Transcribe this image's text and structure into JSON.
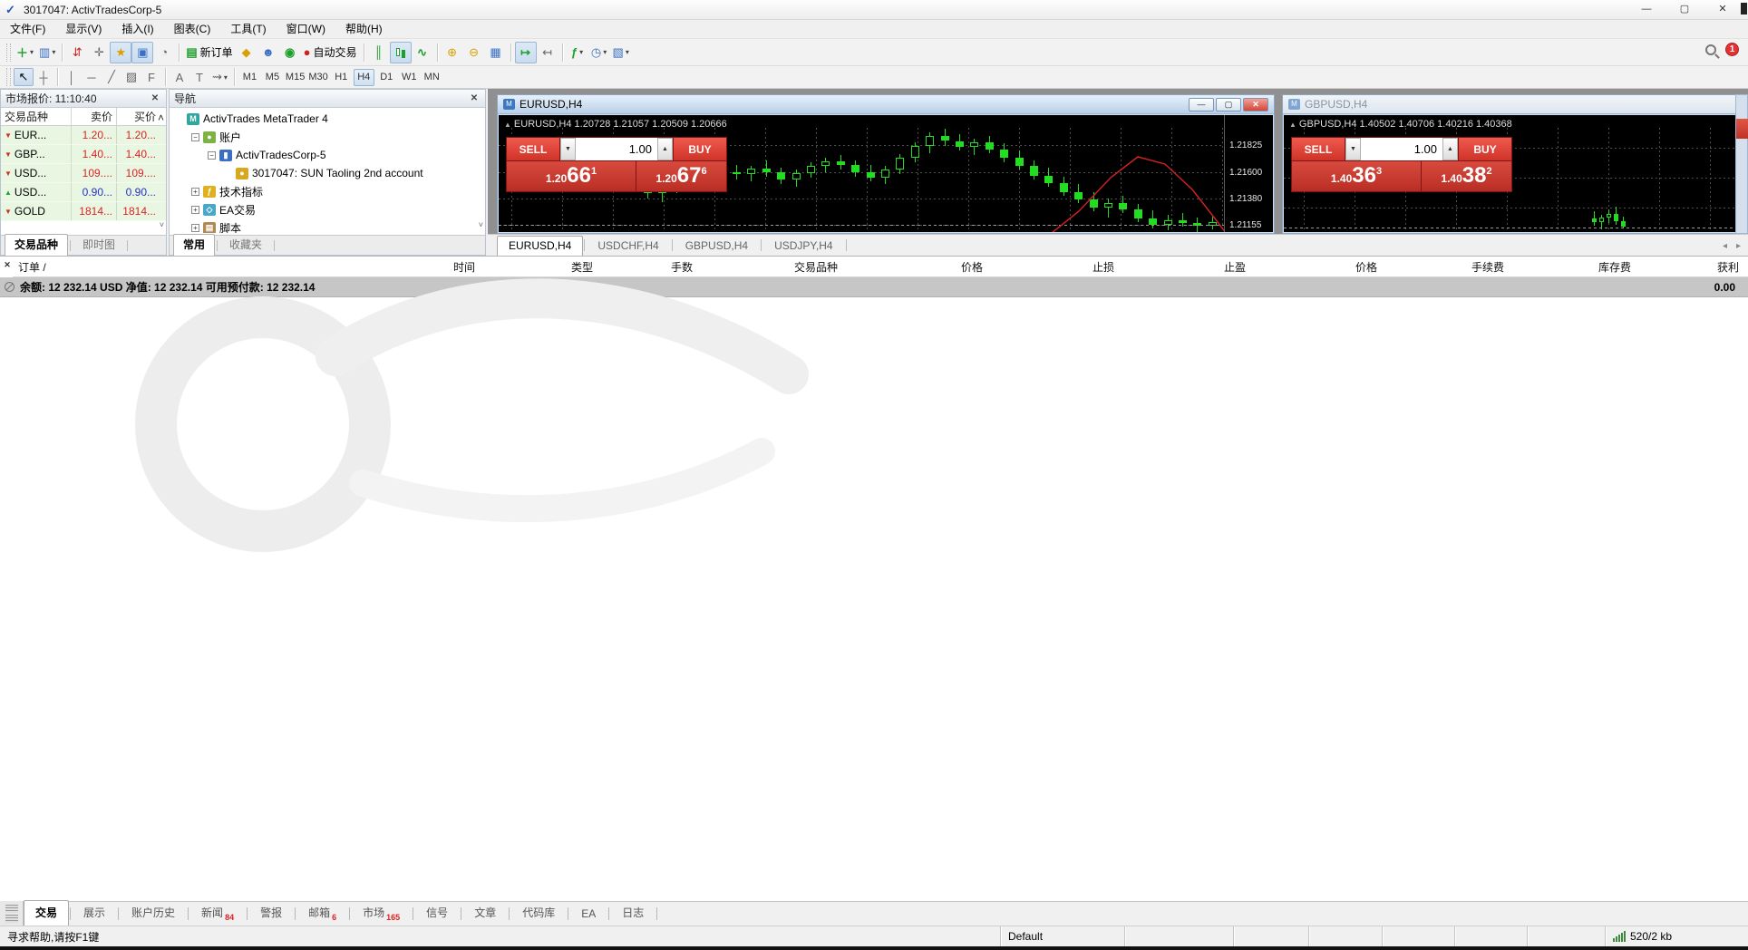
{
  "window": {
    "title": "3017047: ActivTradesCorp-5"
  },
  "icons": {
    "app_logo": "✓",
    "minimize": "—",
    "maximize": "▢",
    "close": "✕",
    "dropdown": "▾",
    "collapse_tri": "▲",
    "new_chart": "＋",
    "profiles": "▥",
    "market_watch": "⇵",
    "data_window": "✛",
    "navigator": "★",
    "terminal_panel": "▣",
    "strategy_tester": "◔",
    "new_order": "▤",
    "metaeditor": "◆",
    "mql_editor": "☻",
    "signals": "◉",
    "autotrading_stop": "●",
    "bar_chart": "║",
    "line_chart": "∿",
    "zoom_in": "⊕",
    "zoom_out": "⊖",
    "tile_windows": "▦",
    "auto_scroll": "↦",
    "chart_shift": "↤",
    "indicators": "ƒ",
    "periods": "◷",
    "templates": "▧",
    "cursor": "↖",
    "crosshair": "┼",
    "vline": "│",
    "hline": "─",
    "trendline": "╱",
    "channel": "▨",
    "fibonacci": "F",
    "text": "A",
    "text_label": "T",
    "arrows_tool": "⇝",
    "scroll_up": "˄",
    "scroll_down": "˅",
    "tab_left": "◂",
    "tab_right": "▸",
    "up_arrow": "▲",
    "down_arrow": "▼",
    "tree_minus": "−",
    "tree_plus": "+",
    "spin_up": "▲",
    "spin_down": "▼",
    "chart_doc": "▤"
  },
  "menu": {
    "items": [
      "文件(F)",
      "显示(V)",
      "插入(I)",
      "图表(C)",
      "工具(T)",
      "窗口(W)",
      "帮助(H)"
    ]
  },
  "toolbar": {
    "new_order_label": "新订单",
    "autotrading_label": "自动交易",
    "notification_count": "1",
    "timeframes": [
      "M1",
      "M5",
      "M15",
      "M30",
      "H1",
      "H4",
      "D1",
      "W1",
      "MN"
    ],
    "active_timeframe": "H4"
  },
  "market_watch": {
    "title": "市场报价: 11:10:40",
    "columns": [
      "交易品种",
      "卖价",
      "买价"
    ],
    "rows": [
      {
        "symbol": "EUR...",
        "bid": "1.20...",
        "ask": "1.20...",
        "dir": "down",
        "trend": "red"
      },
      {
        "symbol": "GBP...",
        "bid": "1.40...",
        "ask": "1.40...",
        "dir": "down",
        "trend": "red"
      },
      {
        "symbol": "USD...",
        "bid": "109....",
        "ask": "109....",
        "dir": "down",
        "trend": "red"
      },
      {
        "symbol": "USD...",
        "bid": "0.90...",
        "ask": "0.90...",
        "dir": "up",
        "trend": "blue"
      },
      {
        "symbol": "GOLD",
        "bid": "1814...",
        "ask": "1814...",
        "dir": "down",
        "trend": "red"
      }
    ],
    "tabs": [
      {
        "label": "交易品种",
        "active": true
      },
      {
        "label": "即时图",
        "active": false
      }
    ]
  },
  "navigator": {
    "title": "导航",
    "tree": [
      {
        "label": "ActivTrades MetaTrader 4",
        "level": 0,
        "icon": "app",
        "toggle": ""
      },
      {
        "label": "账户",
        "level": 1,
        "icon": "accounts",
        "toggle": "minus"
      },
      {
        "label": "ActivTradesCorp-5",
        "level": 2,
        "icon": "server",
        "toggle": "minus"
      },
      {
        "label": "3017047: SUN Taoling 2nd account",
        "level": 3,
        "icon": "account",
        "toggle": ""
      },
      {
        "label": "技术指标",
        "level": 1,
        "icon": "indicator",
        "toggle": "plus"
      },
      {
        "label": "EA交易",
        "level": 1,
        "icon": "ea",
        "toggle": "plus"
      },
      {
        "label": "脚本",
        "level": 1,
        "icon": "script",
        "toggle": "plus"
      }
    ],
    "tabs": [
      {
        "label": "常用",
        "active": true
      },
      {
        "label": "收藏夹",
        "active": false
      }
    ]
  },
  "charts": {
    "eurusd": {
      "title": "EURUSD,H4",
      "ohlc": "EURUSD,H4  1.20728 1.21057 1.20509 1.20666",
      "sell_label": "SELL",
      "buy_label": "BUY",
      "volume": "1.00",
      "bid": {
        "prefix": "1.20",
        "big": "66",
        "sup": "1"
      },
      "ask": {
        "prefix": "1.20",
        "big": "67",
        "sup": "6"
      }
    },
    "gbpusd": {
      "title": "GBPUSD,H4",
      "ohlc": "GBPUSD,H4  1.40502 1.40706 1.40216 1.40368",
      "sell_label": "SELL",
      "buy_label": "BUY",
      "volume": "1.00",
      "bid": {
        "prefix": "1.40",
        "big": "36",
        "sup": "3"
      },
      "ask": {
        "prefix": "1.40",
        "big": "38",
        "sup": "2"
      }
    },
    "tabs": [
      {
        "label": "EURUSD,H4",
        "active": true
      },
      {
        "label": "USDCHF,H4",
        "active": false
      },
      {
        "label": "GBPUSD,H4",
        "active": false
      },
      {
        "label": "USDJPY,H4",
        "active": false
      }
    ]
  },
  "chart_data": [
    {
      "type": "candlestick",
      "symbol": "EURUSD",
      "timeframe": "H4",
      "ohlc_display": [
        1.20728,
        1.21057,
        1.20509,
        1.20666
      ],
      "y_axis": {
        "min": 1.2109,
        "max": 1.2197,
        "ticks": [
          "1.21825",
          "1.21600",
          "1.21380",
          "1.21155"
        ]
      },
      "current_price_line": 1.21155,
      "grid": true,
      "candles": [
        [
          1.2165,
          1.2176,
          1.2158,
          1.217
        ],
        [
          1.217,
          1.2178,
          1.2164,
          1.2166
        ],
        [
          1.2166,
          1.2172,
          1.2156,
          1.216
        ],
        [
          1.216,
          1.2168,
          1.2154,
          1.2165
        ],
        [
          1.2165,
          1.217,
          1.2157,
          1.2161
        ],
        [
          1.2161,
          1.2166,
          1.215,
          1.2153
        ],
        [
          1.2153,
          1.2162,
          1.2147,
          1.2158
        ],
        [
          1.2158,
          1.2164,
          1.2152,
          1.2155
        ],
        [
          1.2155,
          1.216,
          1.2144,
          1.2147
        ],
        [
          1.2147,
          1.2154,
          1.2138,
          1.2142
        ],
        [
          1.2142,
          1.215,
          1.2135,
          1.2146
        ],
        [
          1.2146,
          1.2156,
          1.2142,
          1.2154
        ],
        [
          1.2154,
          1.216,
          1.2148,
          1.2152
        ],
        [
          1.2152,
          1.2158,
          1.2144,
          1.2156
        ],
        [
          1.2156,
          1.2164,
          1.215,
          1.216
        ],
        [
          1.216,
          1.2166,
          1.2154,
          1.2158
        ],
        [
          1.2158,
          1.2165,
          1.2152,
          1.2163
        ],
        [
          1.2163,
          1.217,
          1.2156,
          1.216
        ],
        [
          1.216,
          1.2164,
          1.215,
          1.2154
        ],
        [
          1.2154,
          1.2162,
          1.2148,
          1.2159
        ],
        [
          1.2159,
          1.2168,
          1.2155,
          1.2165
        ],
        [
          1.2165,
          1.2172,
          1.216,
          1.2169
        ],
        [
          1.2169,
          1.2174,
          1.2162,
          1.2166
        ],
        [
          1.2166,
          1.217,
          1.2156,
          1.216
        ],
        [
          1.216,
          1.2166,
          1.2152,
          1.2155
        ],
        [
          1.2155,
          1.2165,
          1.215,
          1.2162
        ],
        [
          1.2162,
          1.2175,
          1.2158,
          1.2172
        ],
        [
          1.2172,
          1.2185,
          1.2168,
          1.2182
        ],
        [
          1.2182,
          1.2193,
          1.2176,
          1.219
        ],
        [
          1.219,
          1.2196,
          1.2182,
          1.2186
        ],
        [
          1.2186,
          1.2192,
          1.2178,
          1.2181
        ],
        [
          1.2181,
          1.2188,
          1.2174,
          1.2185
        ],
        [
          1.2185,
          1.219,
          1.2176,
          1.2179
        ],
        [
          1.2179,
          1.2184,
          1.2168,
          1.2172
        ],
        [
          1.2172,
          1.2178,
          1.2162,
          1.2165
        ],
        [
          1.2165,
          1.217,
          1.2154,
          1.2157
        ],
        [
          1.2157,
          1.2164,
          1.2148,
          1.2151
        ],
        [
          1.2151,
          1.2156,
          1.214,
          1.2143
        ],
        [
          1.2143,
          1.215,
          1.2134,
          1.2137
        ],
        [
          1.2137,
          1.2143,
          1.2127,
          1.213
        ],
        [
          1.213,
          1.2138,
          1.2122,
          1.2134
        ],
        [
          1.2134,
          1.214,
          1.2126,
          1.2129
        ],
        [
          1.2129,
          1.2133,
          1.2118,
          1.2121
        ],
        [
          1.2121,
          1.2128,
          1.2113,
          1.2116
        ],
        [
          1.2116,
          1.2124,
          1.2111,
          1.212
        ],
        [
          1.212,
          1.2126,
          1.2114,
          1.2117
        ],
        [
          1.2117,
          1.2122,
          1.211,
          1.2115
        ],
        [
          1.2115,
          1.2123,
          1.2112,
          1.2118
        ]
      ],
      "overlay": {
        "type": "ma-line",
        "color": "#cc2222",
        "points": [
          [
            595,
            128
          ],
          [
            640,
            92
          ],
          [
            675,
            55
          ],
          [
            705,
            32
          ],
          [
            735,
            40
          ],
          [
            765,
            68
          ],
          [
            790,
            100
          ],
          [
            818,
            137
          ]
        ]
      }
    },
    {
      "type": "candlestick",
      "symbol": "GBPUSD",
      "timeframe": "H4",
      "ohlc_display": [
        1.40502,
        1.40706,
        1.40216,
        1.40368
      ],
      "y_axis": {
        "min": 1.4032,
        "max": 1.412,
        "ticks": []
      },
      "current_price_line": 1.40368,
      "grid": true,
      "candles": [
        [
          1.4044,
          1.405,
          1.4038,
          1.4041
        ],
        [
          1.4041,
          1.4047,
          1.4035,
          1.4045
        ],
        [
          1.4045,
          1.4052,
          1.404,
          1.4048
        ],
        [
          1.4048,
          1.4054,
          1.4039,
          1.4042
        ],
        [
          1.4042,
          1.4046,
          1.4036,
          1.4037
        ]
      ]
    }
  ],
  "terminal": {
    "columns": [
      "订单 /",
      "时间",
      "类型",
      "手数",
      "交易品种",
      "价格",
      "止损",
      "止盈",
      "价格",
      "手续费",
      "库存费",
      "获利"
    ],
    "balance_text": "余额: 12 232.14 USD  净值: 12 232.14  可用预付款: 12 232.14",
    "balance_profit": "0.00",
    "tabs": [
      {
        "label": "交易",
        "active": true,
        "badge": ""
      },
      {
        "label": "展示",
        "active": false,
        "badge": ""
      },
      {
        "label": "账户历史",
        "active": false,
        "badge": ""
      },
      {
        "label": "新闻",
        "active": false,
        "badge": "84"
      },
      {
        "label": "警报",
        "active": false,
        "badge": ""
      },
      {
        "label": "邮箱",
        "active": false,
        "badge": "6"
      },
      {
        "label": "市场",
        "active": false,
        "badge": "165"
      },
      {
        "label": "信号",
        "active": false,
        "badge": ""
      },
      {
        "label": "文章",
        "active": false,
        "badge": ""
      },
      {
        "label": "代码库",
        "active": false,
        "badge": ""
      },
      {
        "label": "EA",
        "active": false,
        "badge": ""
      },
      {
        "label": "日志",
        "active": false,
        "badge": ""
      }
    ]
  },
  "status_bar": {
    "help": "寻求帮助,请按F1键",
    "profile": "Default",
    "traffic": "520/2 kb"
  }
}
